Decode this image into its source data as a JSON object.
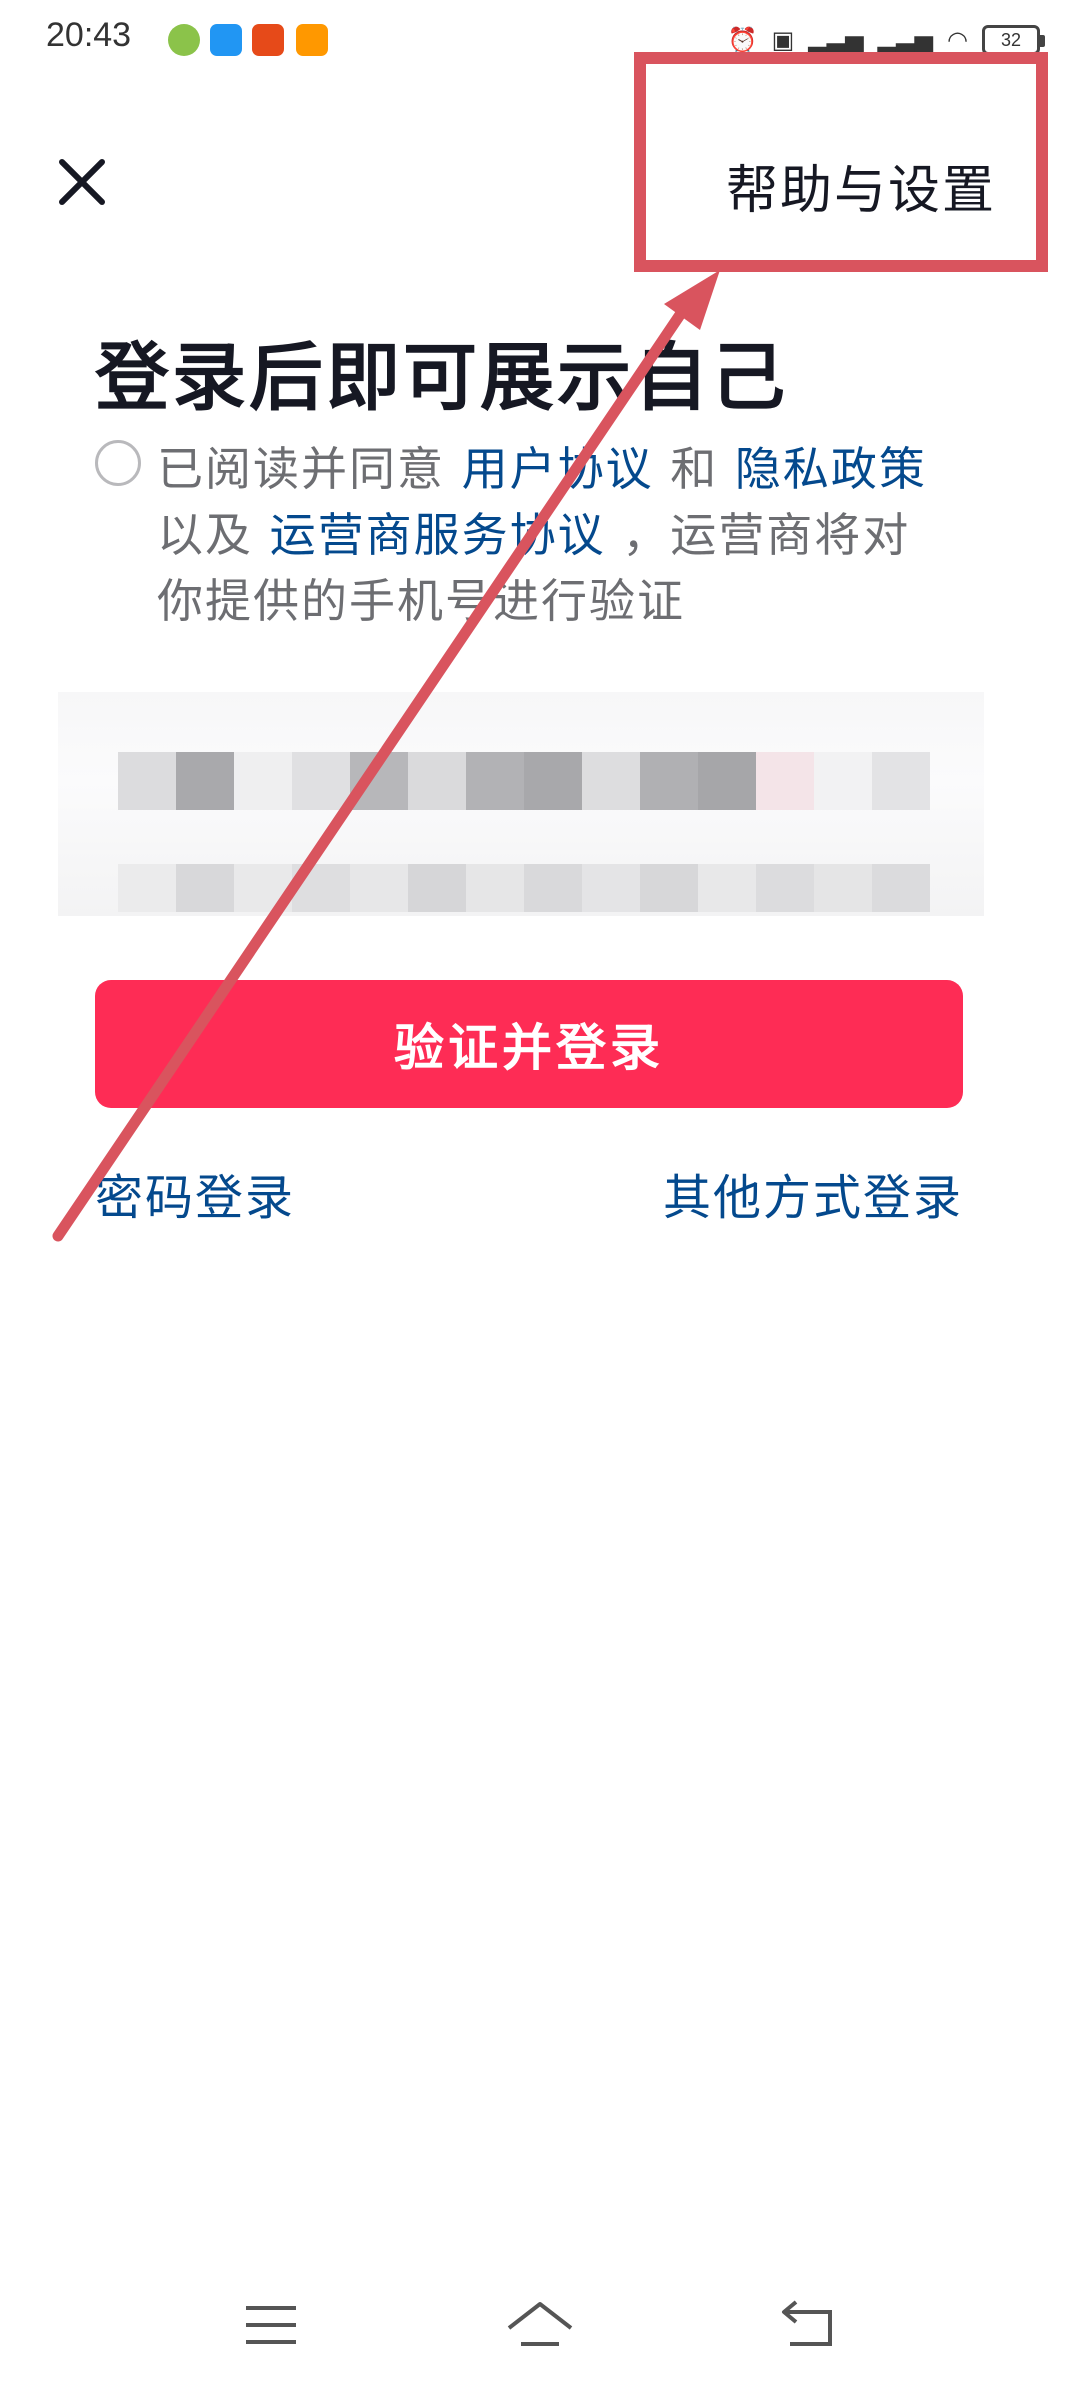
{
  "status_bar": {
    "time": "20:43",
    "apps": [
      "app-icon-green",
      "app-icon-blue",
      "app-icon-red",
      "app-icon-58"
    ],
    "icons": [
      "alarm-icon",
      "hd-icon",
      "signal-icon",
      "5g-signal-icon",
      "wifi-icon"
    ],
    "battery": "32"
  },
  "top_bar": {
    "close_icon": "close-icon",
    "help_settings": "帮助与设置"
  },
  "title": "登录后即可展示自己",
  "agreement": {
    "part1": "已阅读并同意 ",
    "user_agreement": "用户协议",
    "and": " 和 ",
    "privacy_policy": "隐私政策",
    "and_also": " 以及 ",
    "carrier_agreement": "运营商服务协议",
    "part2": " ，运营商将对你提供的手机号进行验证"
  },
  "login_button": "验证并登录",
  "password_login": "密码登录",
  "other_login": "其他方式登录",
  "colors": {
    "accent": "#fe2c55",
    "link": "#04498d",
    "annotation": "#d9545e"
  },
  "nav_bar": {
    "icons": [
      "menu-icon",
      "home-icon",
      "back-icon"
    ]
  }
}
